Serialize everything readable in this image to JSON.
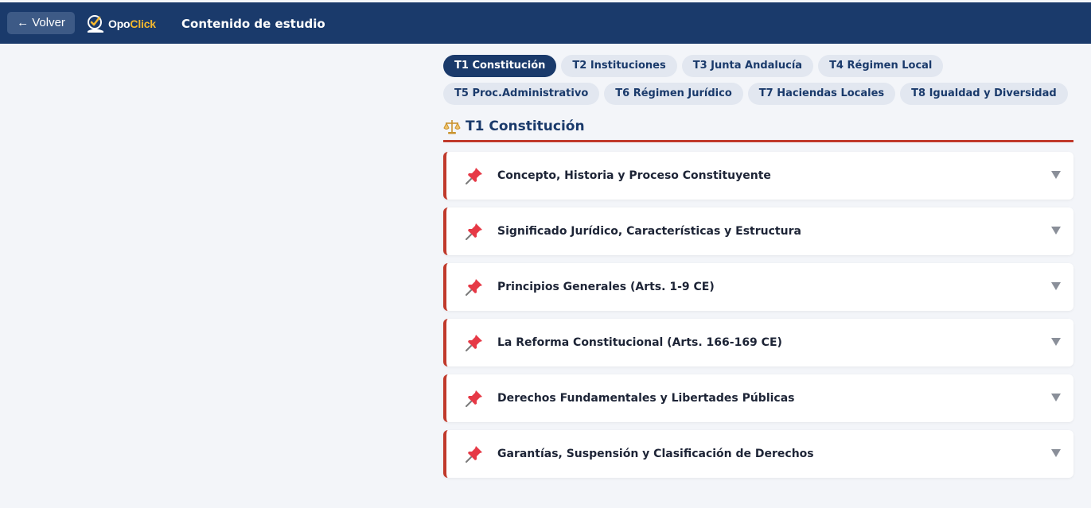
{
  "header": {
    "back_label": "← Volver",
    "logo_text_1": "Opo",
    "logo_text_2": "Click",
    "page_title": "Contenido de estudio"
  },
  "tabs": [
    {
      "label": "T1 Constitución",
      "active": true
    },
    {
      "label": "T2 Instituciones",
      "active": false
    },
    {
      "label": "T3 Junta Andalucía",
      "active": false
    },
    {
      "label": "T4 Régimen Local",
      "active": false
    },
    {
      "label": "T5 Proc.Administrativo",
      "active": false
    },
    {
      "label": "T6 Régimen Jurídico",
      "active": false
    },
    {
      "label": "T7 Haciendas Locales",
      "active": false
    },
    {
      "label": "T8 Igualdad y Diversidad",
      "active": false
    }
  ],
  "section": {
    "icon": "scale-icon",
    "title": "T1 Constitución"
  },
  "cards": [
    {
      "icon": "pin-icon",
      "title": "Concepto, Historia y Proceso Constituyente"
    },
    {
      "icon": "pin-icon",
      "title": "Significado Jurídico, Características y Estructura"
    },
    {
      "icon": "pin-icon",
      "title": "Principios Generales (Arts. 1-9 CE)"
    },
    {
      "icon": "pin-icon",
      "title": "La Reforma Constitucional (Arts. 166-169 CE)"
    },
    {
      "icon": "pin-icon",
      "title": "Derechos Fundamentales y Libertades Públicas"
    },
    {
      "icon": "pin-icon",
      "title": "Garantías, Suspensión y Clasificación de Derechos"
    }
  ],
  "colors": {
    "primary": "#1a3a6b",
    "accent": "#c0392b",
    "logo_accent": "#f5b82e"
  }
}
